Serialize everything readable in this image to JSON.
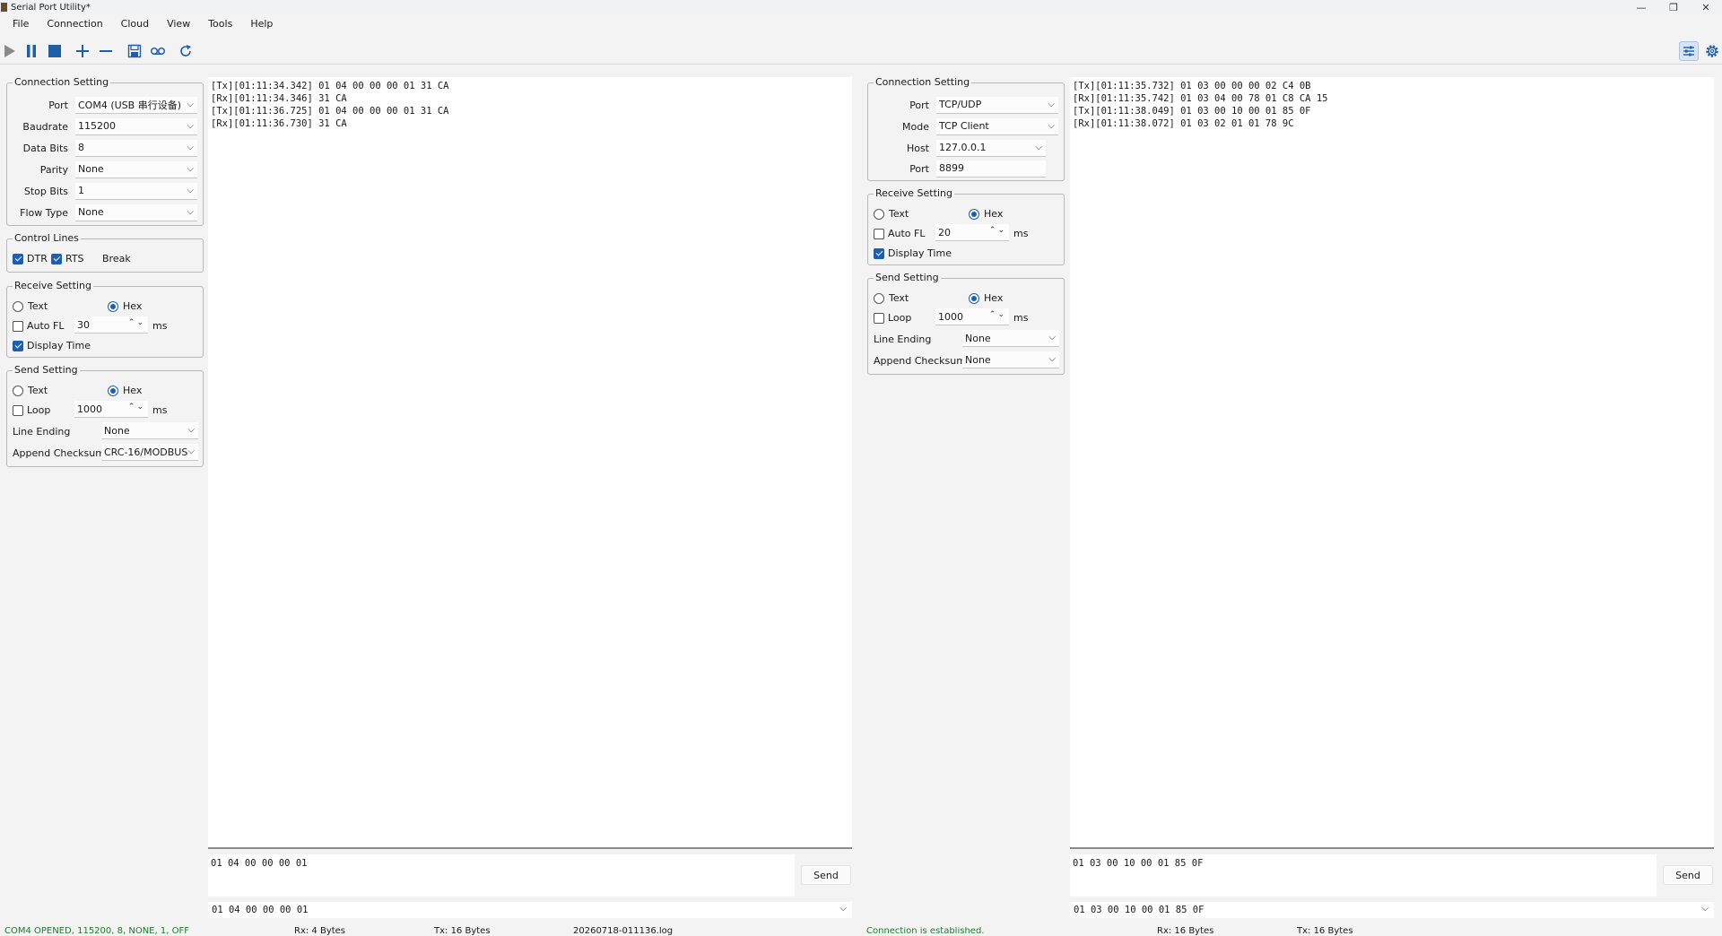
{
  "window": {
    "title": "Serial Port Utility*",
    "minimize": "—",
    "restore": "❐",
    "close": "✕"
  },
  "menu": [
    "File",
    "Connection",
    "Cloud",
    "View",
    "Tools",
    "Help"
  ],
  "toolbar": {
    "icons": [
      "play-icon",
      "pause-icon",
      "stop-icon",
      "plus-icon",
      "minus-icon",
      "save-icon",
      "record-icon",
      "refresh-icon",
      "settings-sliders-icon",
      "gear-icon"
    ]
  },
  "left": {
    "connection": {
      "title": "Connection Setting",
      "rows": [
        {
          "label": "Port",
          "value": "COM4 (USB 串行设备)"
        },
        {
          "label": "Baudrate",
          "value": "115200"
        },
        {
          "label": "Data Bits",
          "value": "8"
        },
        {
          "label": "Parity",
          "value": "None"
        },
        {
          "label": "Stop Bits",
          "value": "1"
        },
        {
          "label": "Flow Type",
          "value": "None"
        }
      ]
    },
    "control": {
      "title": "Control Lines",
      "dtr": "DTR",
      "rts": "RTS",
      "break": "Break"
    },
    "receive": {
      "title": "Receive Setting",
      "text": "Text",
      "hex": "Hex",
      "auto_fl": "Auto FL",
      "auto_fl_value": "30",
      "unit": "ms",
      "display_time": "Display Time"
    },
    "send": {
      "title": "Send Setting",
      "text": "Text",
      "hex": "Hex",
      "loop": "Loop",
      "loop_value": "1000",
      "unit": "ms",
      "line_ending_label": "Line Ending",
      "line_ending_value": "None",
      "checksum_label": "Append Checksum",
      "checksum_value": "CRC-16/MODBUS"
    },
    "log": "[Tx][01:11:34.342] 01 04 00 00 00 01 31 CA\n[Rx][01:11:34.346] 31 CA\n[Tx][01:11:36.725] 01 04 00 00 00 01 31 CA\n[Rx][01:11:36.730] 31 CA",
    "send_text": "01 04 00 00 00 01",
    "send_button": "Send",
    "history": "01 04 00 00 00 01",
    "status": {
      "conn": "COM4 OPENED, 115200, 8, NONE, 1, OFF",
      "rx": "Rx: 4 Bytes",
      "tx": "Tx: 16 Bytes",
      "logfile": "20260718-011136.log"
    }
  },
  "right": {
    "connection": {
      "title": "Connection Setting",
      "port_label": "Port",
      "port_value": "TCP/UDP",
      "mode_label": "Mode",
      "mode_value": "TCP Client",
      "host_label": "Host",
      "host_value": "127.0.0.1",
      "port2_label": "Port",
      "port2_value": "8899"
    },
    "receive": {
      "title": "Receive Setting",
      "text": "Text",
      "hex": "Hex",
      "auto_fl": "Auto FL",
      "auto_fl_value": "20",
      "unit": "ms",
      "display_time": "Display Time"
    },
    "send": {
      "title": "Send Setting",
      "text": "Text",
      "hex": "Hex",
      "loop": "Loop",
      "loop_value": "1000",
      "unit": "ms",
      "line_ending_label": "Line Ending",
      "line_ending_value": "None",
      "checksum_label": "Append Checksum",
      "checksum_value": "None"
    },
    "log": "[Tx][01:11:35.732] 01 03 00 00 00 02 C4 0B\n[Rx][01:11:35.742] 01 03 04 00 78 01 C8 CA 15\n[Tx][01:11:38.049] 01 03 00 10 00 01 85 0F\n[Rx][01:11:38.072] 01 03 02 01 01 78 9C",
    "send_text": "01 03 00 10 00 01 85 0F",
    "send_button": "Send",
    "history": "01 03 00 10 00 01 85 0F",
    "status": {
      "conn": "Connection is established.",
      "rx": "Rx: 16 Bytes",
      "tx": "Tx: 16 Bytes"
    }
  },
  "colors": {
    "accent": "#1a5fb4",
    "status_green": "#1e7a2e",
    "stop_blue": "#1f5fa8"
  }
}
